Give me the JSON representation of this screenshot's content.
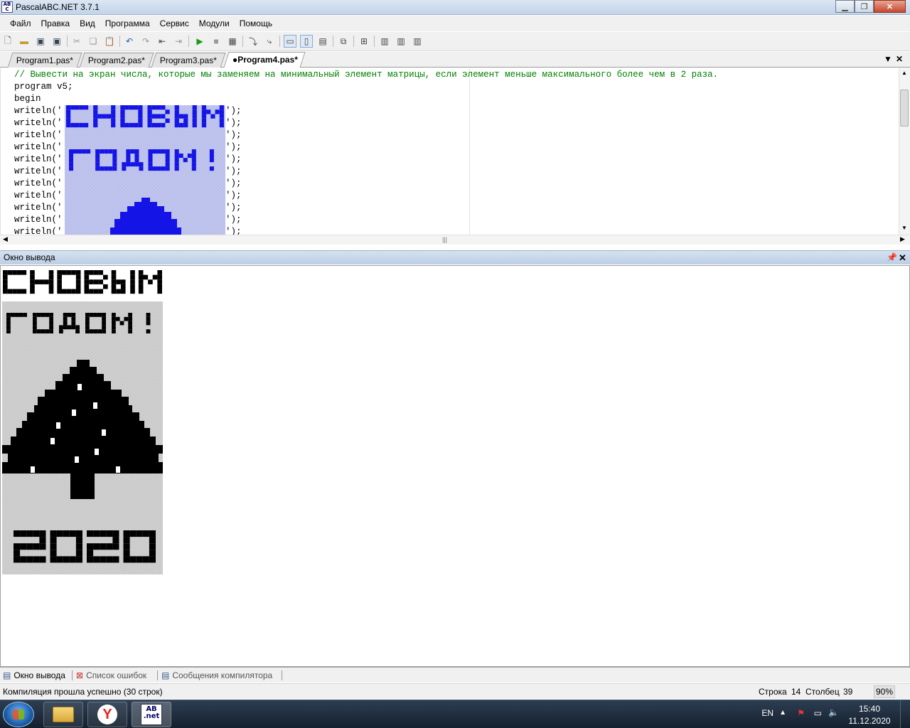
{
  "window": {
    "title": "PascalABC.NET 3.7.1",
    "icon_text": "AB C"
  },
  "menu": [
    "Файл",
    "Правка",
    "Вид",
    "Программа",
    "Сервис",
    "Модули",
    "Помощь"
  ],
  "tabs": [
    {
      "label": "Program1.pas*"
    },
    {
      "label": "Program2.pas*"
    },
    {
      "label": "Program3.pas*"
    },
    {
      "label": "●Program4.pas*"
    }
  ],
  "editor": {
    "comment": "// Вывести на экран числа, которые мы заменяем на минимальный элемент матрицы, если элемент меньше максимального более чем в 2 раза.",
    "lines": [
      "program v5;",
      "begin"
    ],
    "writeln_prefix": "writeln('",
    "writeln_suffix": "');",
    "writeln_count": 11
  },
  "output_pane": {
    "title": "Окно вывода"
  },
  "bottom_tabs": [
    "Окно вывода",
    "Список ошибок",
    "Сообщения компилятора"
  ],
  "status": {
    "message": "Компиляция прошла успешно (30 строк)",
    "row_label": "Строка",
    "row_value": "14",
    "col_label": "Столбец",
    "col_value": "39",
    "zoom": "90%"
  },
  "taskbar": {
    "lang": "EN",
    "time": "15:40",
    "date": "11.12.2020"
  },
  "colors": {
    "banner_blue": "#1414e6",
    "ascii_black": "#000000",
    "comment_green": "#008000"
  }
}
